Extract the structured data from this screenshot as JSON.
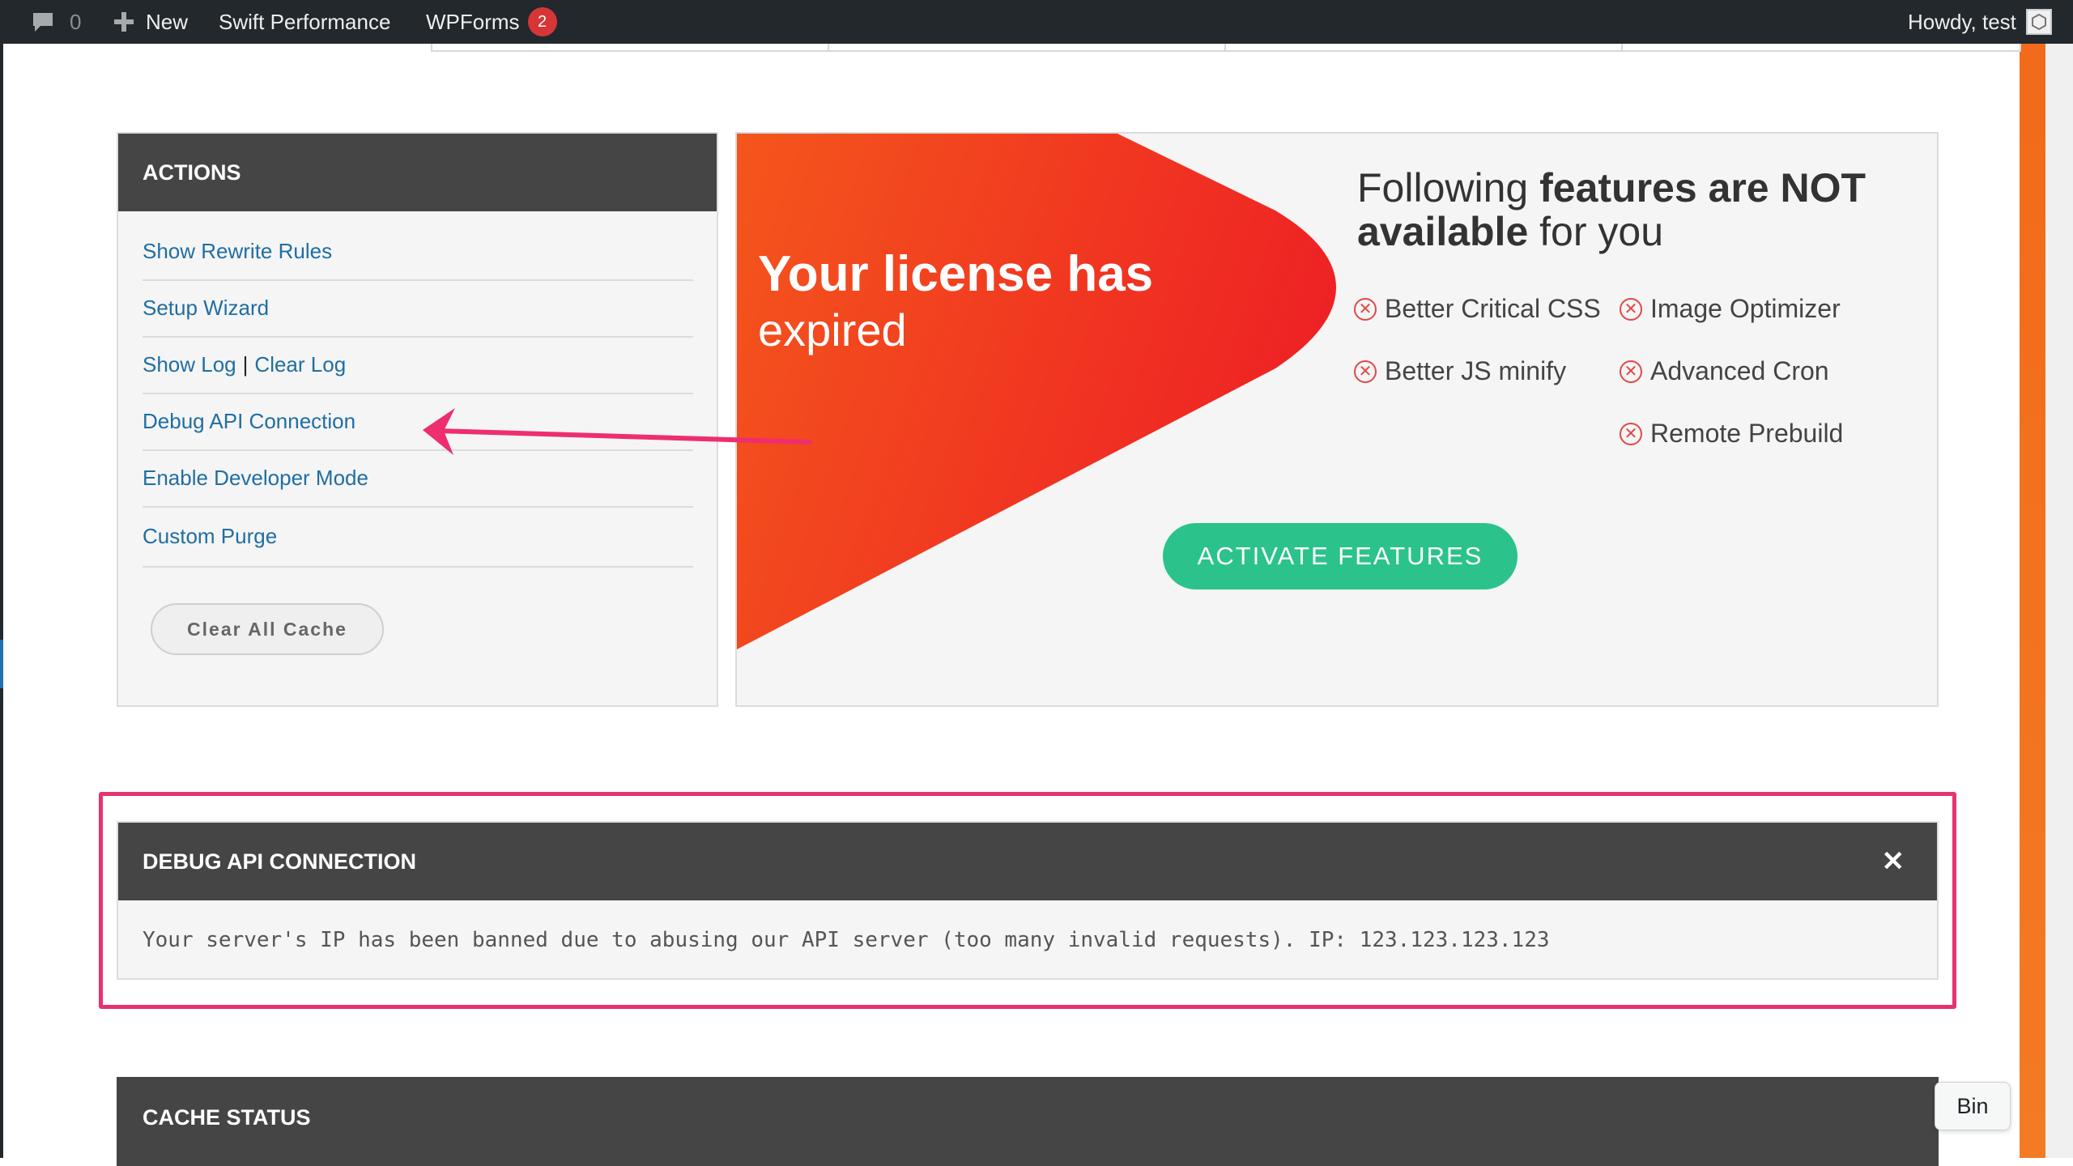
{
  "admin_bar": {
    "comments_count": "0",
    "new_label": "New",
    "swift_label": "Swift Performance",
    "wpforms_label": "WPForms",
    "wpforms_badge": "2",
    "greeting": "Howdy, test"
  },
  "actions": {
    "title": "ACTIONS",
    "items": {
      "rewrite": "Show Rewrite Rules",
      "wizard": "Setup Wizard",
      "show_log": "Show Log",
      "separator": "|",
      "clear_log": "Clear Log",
      "debug_api": "Debug API Connection",
      "developer": "Enable Developer Mode",
      "purge": "Custom Purge"
    },
    "clear_cache_button": "Clear All Cache"
  },
  "license": {
    "title": "Your license has",
    "subtitle": "expired",
    "heading_part1": "Following ",
    "heading_bold": "features are NOT available",
    "heading_part2": " for you",
    "features": [
      "Better Critical CSS",
      "Image Optimizer",
      "Better JS minify",
      "Advanced Cron",
      "Remote Prebuild"
    ],
    "activate_button": "ACTIVATE FEATURES",
    "colors": {
      "red": "#ee2b24",
      "orange": "#f4561c",
      "green": "#2bc38b"
    }
  },
  "debug": {
    "title": "DEBUG API CONNECTION",
    "message": "Your server's IP has been banned due to abusing our API server (too many invalid requests). IP: 123.123.123.123",
    "close_icon": "close-icon"
  },
  "cache_status": {
    "title": "CACHE STATUS"
  },
  "tooltip": {
    "text": "Bin"
  },
  "colors": {
    "highlight": "#e7336e",
    "admin_bar": "#23282d",
    "panel_header": "#454545",
    "link": "#1f6ea3"
  }
}
